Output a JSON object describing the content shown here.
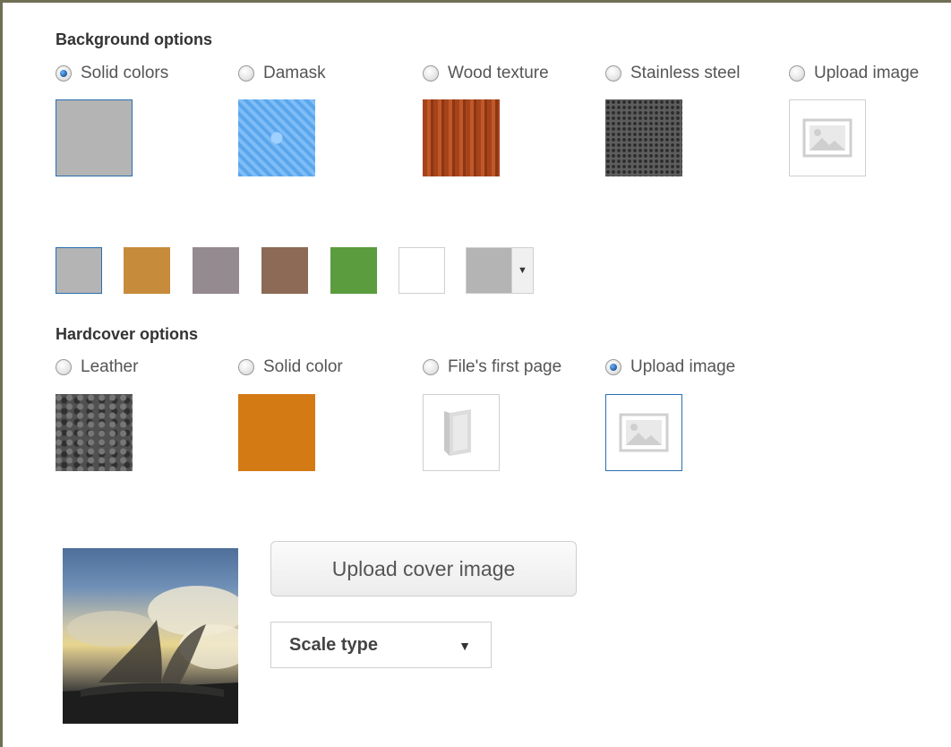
{
  "background": {
    "title": "Background options",
    "options": [
      {
        "label": "Solid colors",
        "selected": true
      },
      {
        "label": "Damask",
        "selected": false
      },
      {
        "label": "Wood texture",
        "selected": false
      },
      {
        "label": "Stainless steel",
        "selected": false
      },
      {
        "label": "Upload image",
        "selected": false
      }
    ],
    "swatches": [
      "#b4b4b4",
      "#c78b3c",
      "#948a90",
      "#8c6a55",
      "#5a9c3e",
      "#ffffff"
    ],
    "dropdown_color": "#b4b4b4",
    "dropdown_icon": "caret-down-icon"
  },
  "hardcover": {
    "title": "Hardcover options",
    "options": [
      {
        "label": "Leather",
        "selected": false
      },
      {
        "label": "Solid color",
        "selected": false
      },
      {
        "label": "File's first page",
        "selected": false
      },
      {
        "label": "Upload image",
        "selected": true
      }
    ],
    "solid_color": "#d47a14"
  },
  "cover": {
    "upload_button": "Upload cover image",
    "scale_select": "Scale type",
    "scale_arrow": "▼"
  },
  "colors": {
    "selection_border": "#2a6fb1",
    "accent_blue": "#1f5e9c"
  }
}
